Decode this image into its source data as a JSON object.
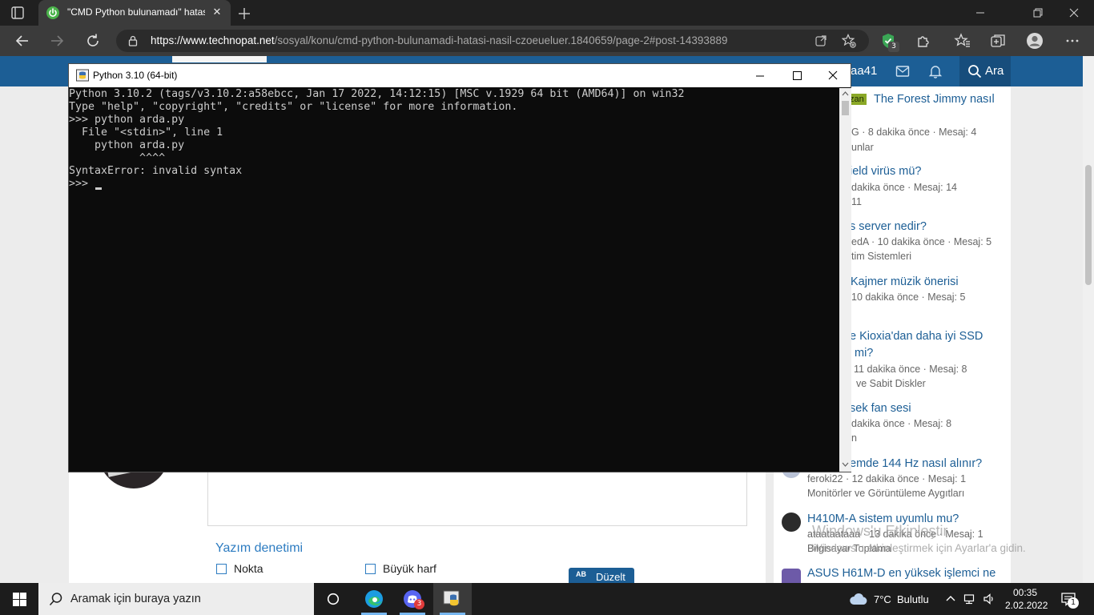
{
  "browser": {
    "tab": {
      "title": "\"CMD Python bulunamadı\" hatası nasıl çözülür?",
      "close": "✕"
    },
    "url": {
      "host": "https://www.technopat.net",
      "path": "/sosyal/konu/cmd-python-bulunamadi-hatasi-nasil-czoeueluer.1840659/page-2#post-14393889"
    },
    "extension_badge": "3"
  },
  "site": {
    "username": "aa41",
    "search_label": "Ara",
    "sidebar": [
      {
        "badge": "zan",
        "title": "The Forest Jimmy nasıl",
        "meta": "G · 8 dakika önce · Mesaj: 4",
        "forum": "unlar"
      },
      {
        "title": "ield virüs mü?",
        "meta": "dakika önce · Mesaj: 14",
        "forum": "11"
      },
      {
        "title": "s server nedir?",
        "meta": "edA · 10 dakika önce · Mesaj: 5",
        "forum": "tim Sistemleri"
      },
      {
        "title": "Kajmer müzik önerisi",
        "meta": "10 dakika önce · Mesaj: 5"
      },
      {
        "title": "e Kioxia'dan daha iyi SSD",
        "title2": "mi?",
        "meta": "11 dakika önce · Mesaj: 8",
        "forum": "ve Sabit Diskler"
      },
      {
        "title": "sek fan sesi",
        "meta": "dakika önce · Mesaj: 8",
        "forum": "n"
      },
      {
        "title": "emde 144 Hz nasıl alınır?",
        "meta": "feroki22 · 12 dakika önce · Mesaj: 1",
        "forum": "Monitörler ve Görüntüleme Aygıtları"
      },
      {
        "title": "H410M-A sistem uyumlu mu?",
        "meta": "ataataataaa · 13 dakika önce · Mesaj: 1",
        "forum": "Bilgisayar Toplama"
      },
      {
        "title": "ASUS H61M-D en yüksek işlemci ne"
      }
    ],
    "spellcheck": {
      "title": "Yazım denetimi",
      "opt1": "Nokta",
      "opt2": "Büyük harf",
      "fix_icon": "AB",
      "fix_label": "Düzelt"
    }
  },
  "watermark": {
    "line1": "Windows'u Etkinleştir",
    "line2": "Windows'u etkinleştirmek için Ayarlar'a gidin."
  },
  "console": {
    "title": "Python 3.10 (64-bit)",
    "lines": [
      "Python 3.10.2 (tags/v3.10.2:a58ebcc, Jan 17 2022, 14:12:15) [MSC v.1929 64 bit (AMD64)] on win32",
      "Type \"help\", \"copyright\", \"credits\" or \"license\" for more information.",
      ">>> python arda.py",
      "  File \"<stdin>\", line 1",
      "    python arda.py",
      "           ^^^^",
      "SyntaxError: invalid syntax",
      ">>> "
    ]
  },
  "taskbar": {
    "search_placeholder": "Aramak için buraya yazın",
    "discord_badge": "3",
    "weather_temp": "7°C",
    "weather_condition": "Bulutlu",
    "time": "00:35",
    "date": "2.02.2022",
    "notification_count": "1"
  },
  "colors": {
    "site_header": "#1c5e95",
    "link": "#1c5e95",
    "console_bg": "#0c0c0c",
    "console_text": "#cccccc",
    "edge_shield": "#3aa655"
  }
}
